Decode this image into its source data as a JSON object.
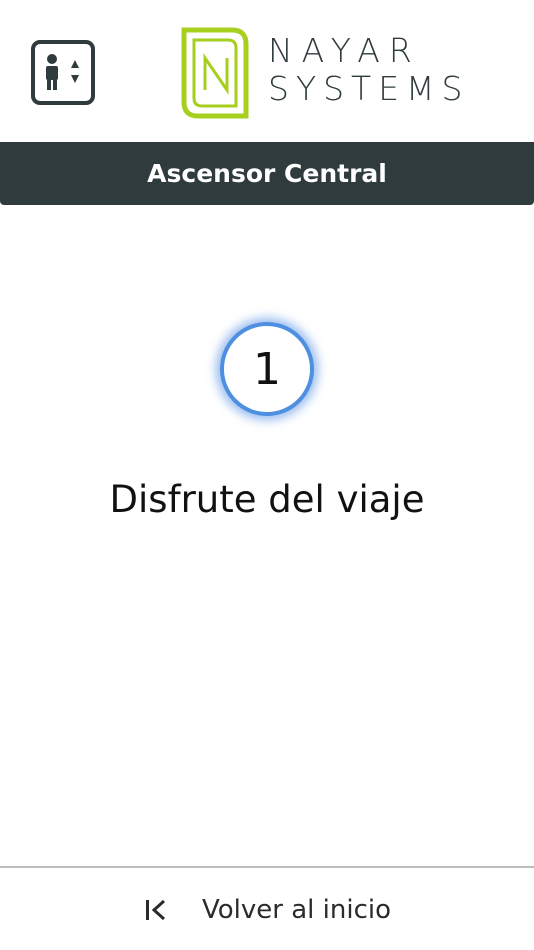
{
  "header": {
    "elevator_icon": "elevator-person-up-down-icon",
    "logo": {
      "line1": "NAYAR",
      "line2": "SYSTEMS",
      "mark_letter": "N",
      "mark_color": "#a6cf1e",
      "text_color": "#2f3b3d"
    }
  },
  "title_bar": {
    "title": "Ascensor Central",
    "background": "#2f3b3d"
  },
  "status": {
    "floor": "1",
    "message": "Disfrute del viaje",
    "ring_color": "#4f8fe0"
  },
  "footer": {
    "back_icon": "chevron-left-bar-icon",
    "back_label": "Volver al inicio"
  }
}
